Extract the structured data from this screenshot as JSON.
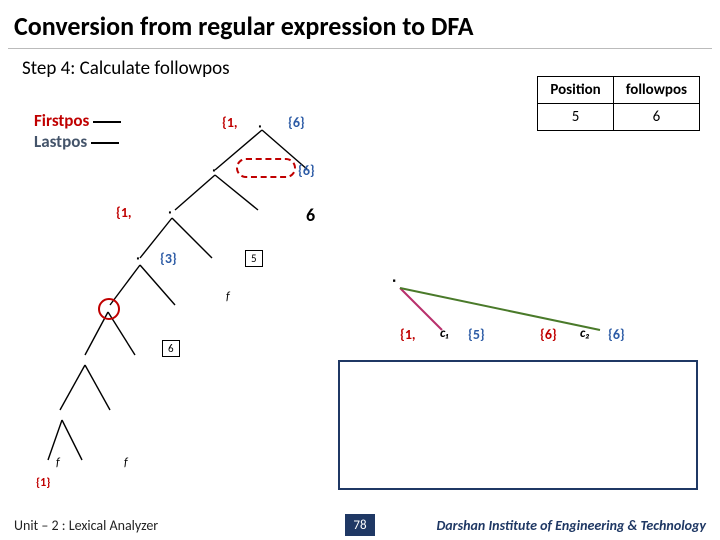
{
  "title": "Conversion from regular expression to DFA",
  "subtitle": "Step 4: Calculate followpos",
  "legend": {
    "firstpos": "Firstpos",
    "lastpos": "Lastpos"
  },
  "table": {
    "headers": [
      "Position",
      "followpos"
    ],
    "row": [
      "5",
      "6"
    ]
  },
  "tree": {
    "root_set_left": "{1,",
    "root_set_right": "{6}",
    "n2_set_right": "{6}",
    "n3_pos": "6",
    "n4_set_left": "{1,",
    "n5_set_right": "{3}",
    "box5": "5",
    "box6": "6",
    "sym_f1": "f",
    "sym_f2": "f",
    "sym_f3": "f",
    "leaf_set": "{1}"
  },
  "overlay": {
    "dot": "∙",
    "left_set": "{1,",
    "c1": "c₁",
    "c1_set": "{5}",
    "mid_set": "{6}",
    "c2": "c₂",
    "c2_set": "{6}"
  },
  "footer": {
    "left": "Unit – 2  : Lexical Analyzer",
    "page": "78",
    "right": "Darshan Institute of Engineering & Technology"
  }
}
